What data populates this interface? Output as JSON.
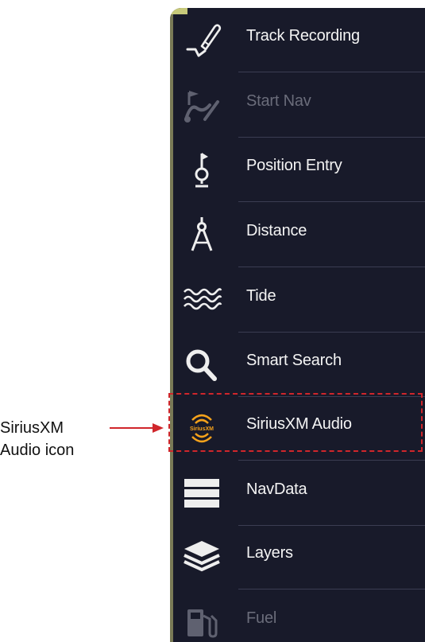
{
  "menu": {
    "items": [
      {
        "label": "Track Recording",
        "icon": "track-recording-icon",
        "disabled": false
      },
      {
        "label": "Start Nav",
        "icon": "start-nav-icon",
        "disabled": true
      },
      {
        "label": "Position Entry",
        "icon": "position-entry-icon",
        "disabled": false
      },
      {
        "label": "Distance",
        "icon": "distance-compass-icon",
        "disabled": false
      },
      {
        "label": "Tide",
        "icon": "tide-icon",
        "disabled": false
      },
      {
        "label": "Smart Search",
        "icon": "search-icon",
        "disabled": false
      },
      {
        "label": "SiriusXM Audio",
        "icon": "siriusxm-icon",
        "disabled": false
      },
      {
        "label": "NavData",
        "icon": "navdata-icon",
        "disabled": false
      },
      {
        "label": "Layers",
        "icon": "layers-icon",
        "disabled": false
      },
      {
        "label": "Fuel",
        "icon": "fuel-icon",
        "disabled": true
      }
    ]
  },
  "callout": {
    "line1": "SiriusXM",
    "line2": "Audio icon"
  },
  "colors": {
    "panel_bg": "#181a2a",
    "highlight": "#d0262b",
    "siriusxm_logo": "#f5a21b"
  }
}
